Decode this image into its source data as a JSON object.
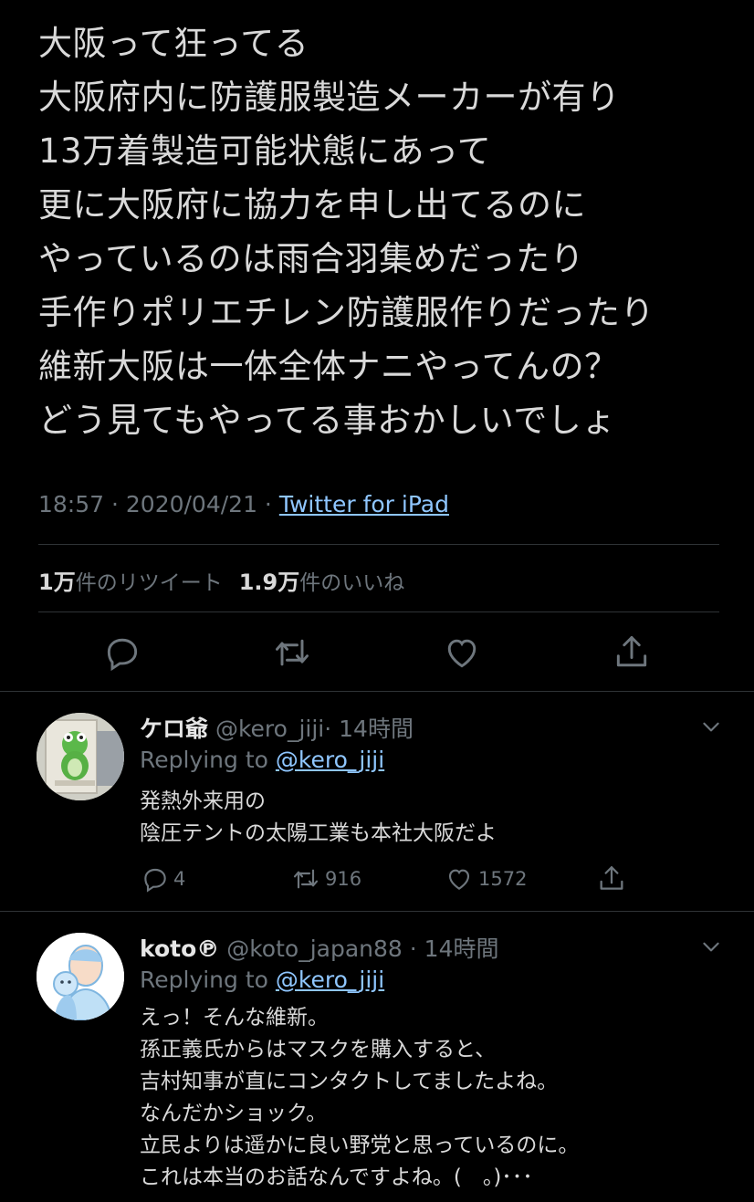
{
  "tweet": {
    "lines": [
      "大阪って狂ってる",
      "大阪府内に防護服製造メーカーが有り",
      "13万着製造可能状態にあって",
      "更に大阪府に協力を申し出てるのに",
      "やっているのは雨合羽集めだったり",
      "手作りポリエチレン防護服作りだったり",
      "維新大阪は一体全体ナニやってんの？",
      "どう見てもやってる事おかしいでしょ"
    ],
    "time": "18:57 · 2020/04/21 · ",
    "source": "Twitter for iPad",
    "retweet_count": "1万",
    "retweet_label": "件のリツイート",
    "like_count": "1.9万",
    "like_label": "件のいいね"
  },
  "actions": {
    "reply_icon": "reply-icon",
    "retweet_icon": "retweet-icon",
    "like_icon": "heart-icon",
    "share_icon": "share-icon"
  },
  "replies": [
    {
      "name": "ケロ爺",
      "handle": "@kero_jiji",
      "time": "· 14時間",
      "replying_prefix": "Replying to ",
      "replying_to": "@kero_jiji",
      "lines": [
        "発熱外来用の",
        "陰圧テントの太陽工業も本社大阪だよ"
      ],
      "reply_count": "4",
      "retweet_count": "916",
      "like_count": "1572"
    },
    {
      "name": "koto℗",
      "handle": "@koto_japan88",
      "time": "· 14時間",
      "replying_prefix": "Replying to ",
      "replying_to": "@kero_jiji",
      "lines": [
        "えっ！そんな維新。",
        "孫正義氏からはマスクを購入すると、",
        "吉村知事が直にコンタクトしてましたよね。",
        "なんだかショック。",
        "立民よりは遥かに良い野党と思っているのに。",
        "これは本当のお話なんですよね。(　。)･･･"
      ]
    }
  ],
  "colors": {
    "background": "#000000",
    "text": "#d9d9d9",
    "muted": "#6e767d",
    "link": "#8fc6ff",
    "divider": "#2f3336"
  }
}
